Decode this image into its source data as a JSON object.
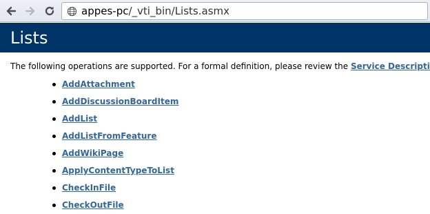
{
  "browser": {
    "url_host": "appes-pc",
    "url_path": "/_vti_bin/Lists.asmx",
    "icons": {
      "back": "back-arrow-icon",
      "forward": "forward-arrow-icon",
      "reload": "reload-icon",
      "site": "globe-icon"
    }
  },
  "page": {
    "title": "Lists",
    "intro_text": "The following operations are supported. For a formal definition, please review the ",
    "intro_link": "Service Description",
    "intro_end": ".",
    "operations": [
      "AddAttachment",
      "AddDiscussionBoardItem",
      "AddList",
      "AddListFromFeature",
      "AddWikiPage",
      "ApplyContentTypeToList",
      "CheckInFile",
      "CheckOutFile"
    ]
  },
  "colors": {
    "banner": "#003366",
    "link": "#336699"
  }
}
